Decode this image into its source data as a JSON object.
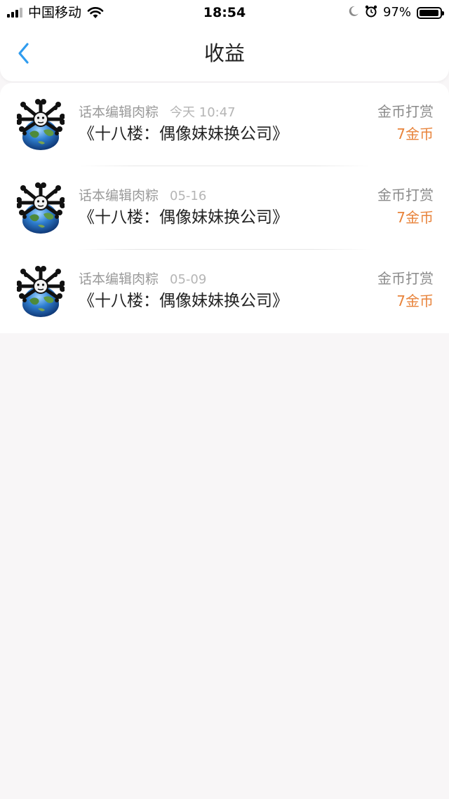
{
  "status_bar": {
    "carrier": "中国移动",
    "time": "18:54",
    "battery_percent": "97%"
  },
  "nav": {
    "title": "收益",
    "back_icon": "chevron-left-icon",
    "accent_color": "#2f9cef"
  },
  "rows": [
    {
      "author": "话本编辑肉粽",
      "date": "今天 10:47",
      "book": "《十八楼：偶像妹妹换公司》",
      "type": "金币打赏",
      "amount": "7金币"
    },
    {
      "author": "话本编辑肉粽",
      "date": "05-16",
      "book": "《十八楼：偶像妹妹换公司》",
      "type": "金币打赏",
      "amount": "7金币"
    },
    {
      "author": "话本编辑肉粽",
      "date": "05-09",
      "book": "《十八楼：偶像妹妹换公司》",
      "type": "金币打赏",
      "amount": "7金币"
    }
  ],
  "colors": {
    "amount": "#e8833a",
    "page_background": "#f8f6f7"
  }
}
